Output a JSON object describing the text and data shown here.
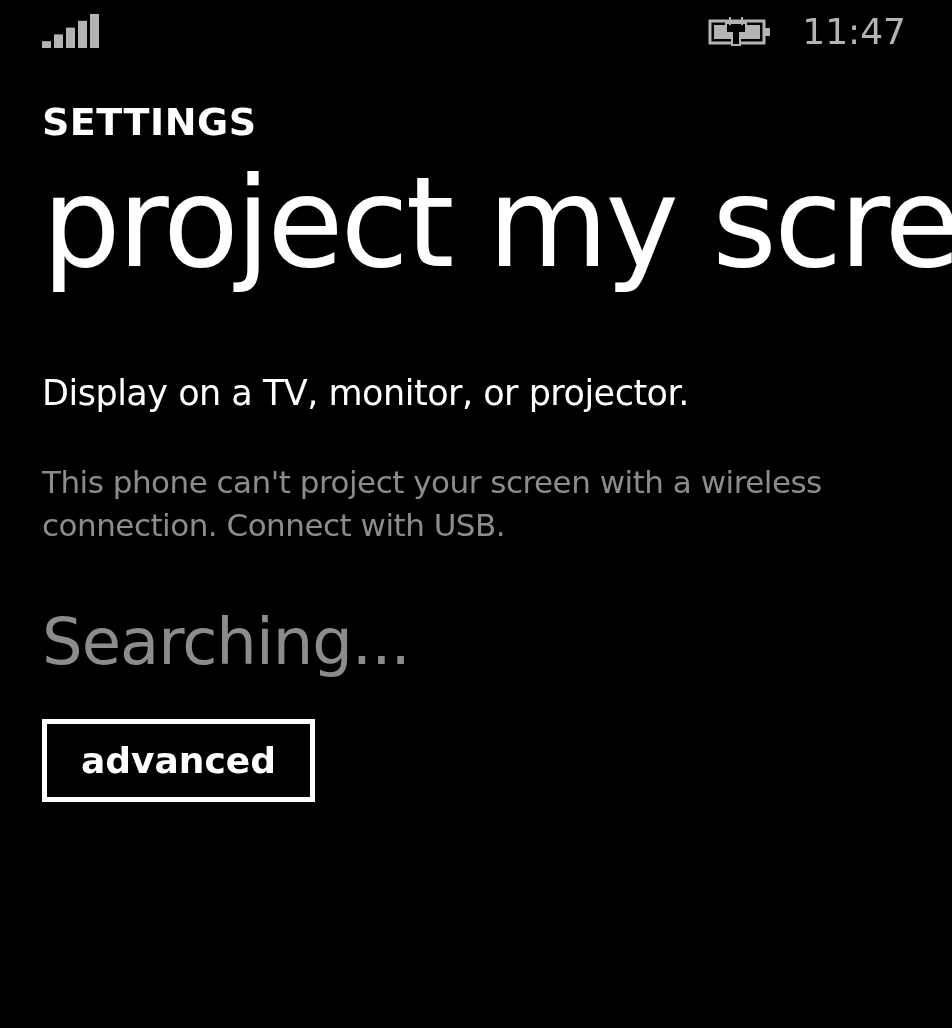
{
  "status_bar": {
    "time": "11:47"
  },
  "header": {
    "section": "SETTINGS",
    "title": "project my scre"
  },
  "description": "Display on a TV, monitor, or projector.",
  "note": "This phone can't project your screen with a wireless connection. Connect with USB.",
  "status": "Searching...",
  "buttons": [
    "advanced"
  ]
}
